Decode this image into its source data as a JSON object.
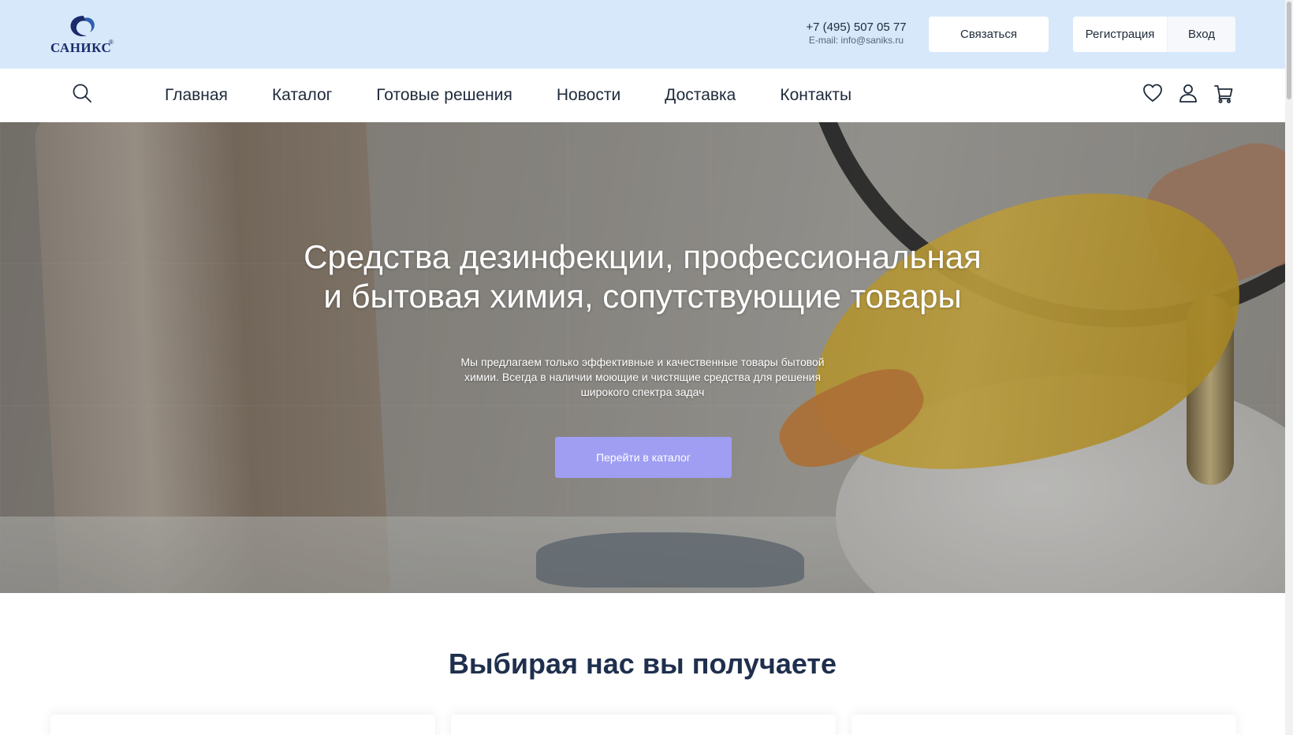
{
  "header": {
    "logo_text": "САНИКС",
    "logo_reg": "®",
    "phone": "+7 (495) 507 05 77",
    "email": "E-mail: info@saniks.ru",
    "contact_button": "Связаться",
    "register_button": "Регистрация",
    "login_button": "Вход"
  },
  "nav": {
    "items": [
      {
        "label": "Главная"
      },
      {
        "label": "Каталог"
      },
      {
        "label": "Готовые решения"
      },
      {
        "label": "Новости"
      },
      {
        "label": "Доставка"
      },
      {
        "label": "Контакты"
      }
    ],
    "icons": [
      "search-icon",
      "heart-icon",
      "user-icon",
      "cart-icon"
    ]
  },
  "hero": {
    "title_line1": "Средства дезинфекции, профессиональная",
    "title_line2": "и бытовая химия, сопутствующие товары",
    "subtitle_line1": "Мы предлагаем только эффективные и качественные товары бытовой",
    "subtitle_line2": "химии. Всегда в наличии моющие и чистящие средства для решения",
    "subtitle_line3": "широкого спектра задач",
    "cta_button": "Перейти в каталог"
  },
  "section": {
    "title": "Выбирая нас вы получаете"
  },
  "colors": {
    "topbar_bg": "#d6e8fa",
    "cta_bg": "#9f9ef3",
    "text_dark": "#1e2a3a",
    "section_title": "#1f2f4d"
  }
}
